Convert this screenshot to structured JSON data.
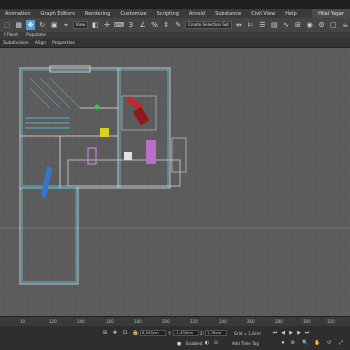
{
  "menu": [
    "Animation",
    "Graph Editors",
    "Rendering",
    "Customize",
    "Scripting",
    "Arnold",
    "Substance",
    "Civil View",
    "Help"
  ],
  "user": "Hilal Yaşar",
  "toolbar": {
    "view_dropdown": "View",
    "selection_set": "Create Selection Set"
  },
  "ribbon": {
    "tabs": [
      "f Paint",
      "Populate"
    ],
    "sub": [
      "Subdivision",
      "Align",
      "Properties"
    ]
  },
  "timeline": {
    "ticks": [
      "10",
      "120",
      "140",
      "160",
      "180",
      "200",
      "220",
      "240",
      "260",
      "280",
      "300",
      "320"
    ]
  },
  "status": {
    "coord_x": "8,545cm",
    "coord_y": "-1,434cm",
    "coord_z": "1,78cm",
    "grid": "Grid = 1,6cm",
    "add_time_tag": "Add Time Tag",
    "enabled": "Enabled:"
  },
  "colors": {
    "accent": "#5a9bd5",
    "wire_cyan": "#4fd2e6",
    "wire_white": "#e6e6e6",
    "furniture_red": "#c8262b",
    "furniture_yellow": "#d8d31a",
    "furniture_pink": "#c985d8",
    "floor_blue": "#3a74c9"
  }
}
